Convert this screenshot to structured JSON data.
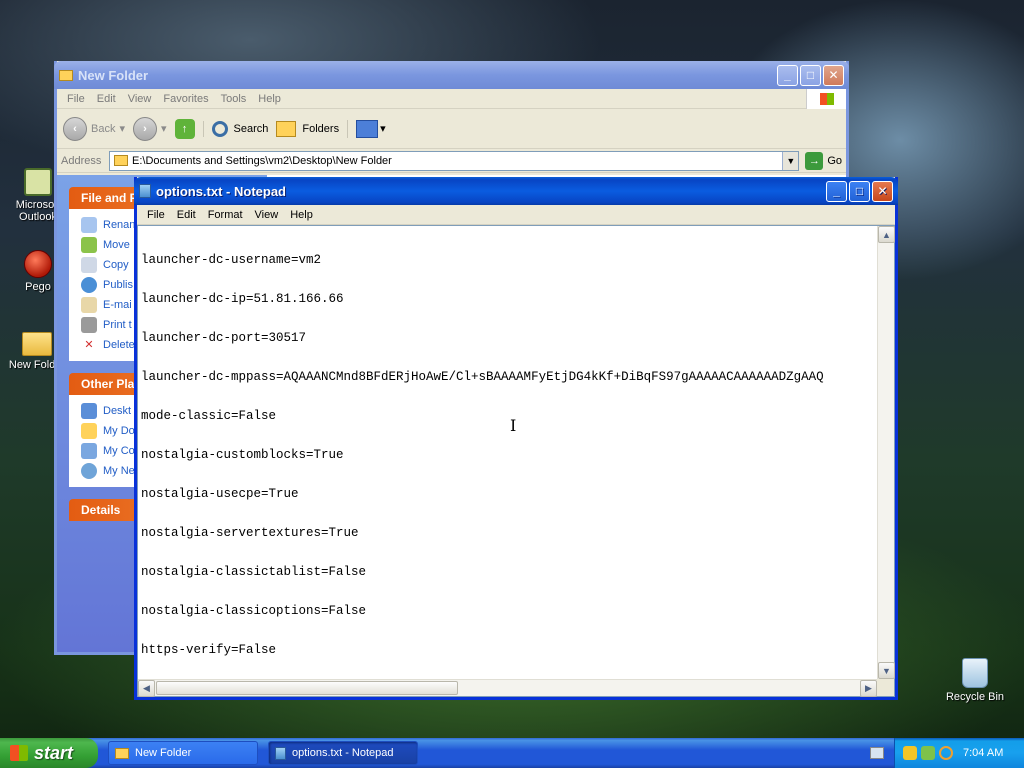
{
  "desktop": {
    "icons": [
      {
        "label": "Microsoft Outlook"
      },
      {
        "label": "Pego"
      },
      {
        "label": "New Folder"
      },
      {
        "label": "Recycle Bin"
      }
    ]
  },
  "explorer": {
    "title": "New Folder",
    "menu": [
      "File",
      "Edit",
      "View",
      "Favorites",
      "Tools",
      "Help"
    ],
    "toolbar": {
      "back": "Back",
      "search": "Search",
      "folders": "Folders"
    },
    "address_label": "Address",
    "address_value": "E:\\Documents and Settings\\vm2\\Desktop\\New Folder",
    "go_label": "Go",
    "taskpane": {
      "file_tasks_header": "File and F",
      "file_tasks": [
        "Renan",
        "Move",
        "Copy",
        "Publis",
        "E-mai",
        "Print t",
        "Delete"
      ],
      "other_places_header": "Other Pla",
      "other_places": [
        "Deskt",
        "My Do",
        "My Co",
        "My Ne"
      ],
      "details_header": "Details"
    }
  },
  "notepad": {
    "title": "options.txt - Notepad",
    "menu": [
      "File",
      "Edit",
      "Format",
      "View",
      "Help"
    ],
    "lines": [
      "launcher-dc-username=vm2",
      "launcher-dc-ip=51.81.166.66",
      "launcher-dc-port=30517",
      "launcher-dc-mppass=AQAAANCMnd8BFdERjHoAwE/Cl+sBAAAAMFyEtjDG4kKf+DiBqFS97gAAAAACAAAAAADZgAAQ",
      "mode-classic=False",
      "nostalgia-customblocks=True",
      "nostalgia-usecpe=True",
      "nostalgia-servertextures=True",
      "nostalgia-classictablist=False",
      "nostalgia-classicoptions=False",
      "https-verify=False"
    ]
  },
  "taskbar": {
    "start_label": "start",
    "items": [
      "New Folder",
      "options.txt - Notepad"
    ],
    "clock": "7:04 AM"
  }
}
